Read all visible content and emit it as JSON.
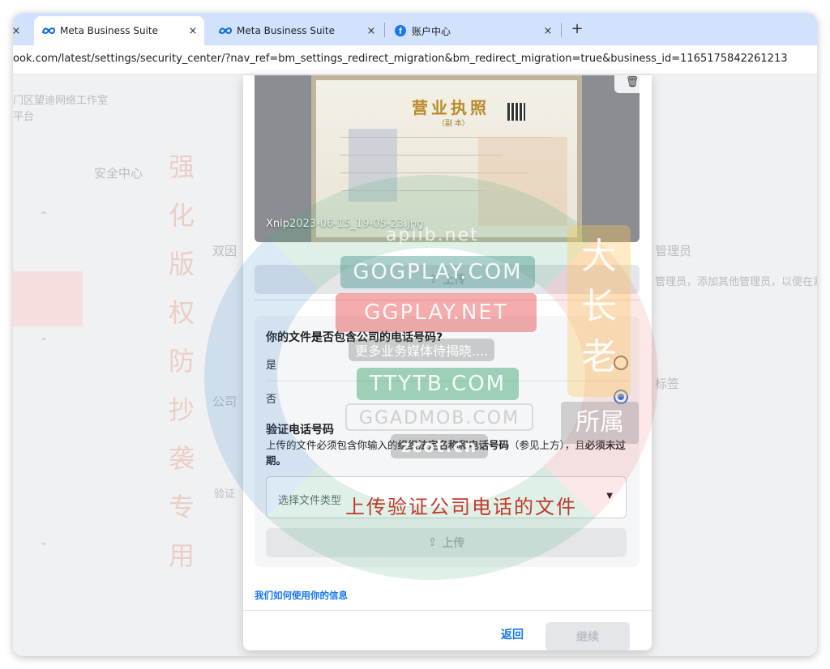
{
  "browser": {
    "tabs": [
      {
        "title": "Meta Business Suite",
        "icon": "meta-icon"
      },
      {
        "title": "Meta Business Suite",
        "icon": "meta-icon"
      },
      {
        "title": "账户中心",
        "icon": "facebook-icon"
      }
    ],
    "close_glyph": "×",
    "new_tab_glyph": "+",
    "url": "ook.com/latest/settings/security_center/?nav_ref=bm_settings_redirect_migration&bm_redirect_migration=true&business_id=1165175842261213"
  },
  "background": {
    "company_line": "门区望迪网络工作室",
    "company_sub": "平台",
    "security_center": "安全中心",
    "admin_heading": "管理员",
    "admin_desc": "管理员，添加其他管理员，以便在紧",
    "label_heading": "标签",
    "side_texts": [
      "双因",
      "公司",
      "验证"
    ]
  },
  "modal": {
    "file_name": "Xnip2023-06-15_19-05-23.jpg",
    "trash_icon": "trash-icon",
    "upload_label": "上传",
    "question": "你的文件是否包含公司的电话号码?",
    "options": [
      {
        "label": "是",
        "checked": false
      },
      {
        "label": "否",
        "checked": true
      }
    ],
    "verify_title": "验证电话号码",
    "verify_desc_pre": "上传的文件必须包含你输入的",
    "verify_desc_bold": "组织法定名称和电话号码",
    "verify_desc_mid": "（参见上方），且",
    "verify_desc_bold2": "必须未过期。",
    "select_placeholder": "选择文件类型",
    "upload_label_2": "上传",
    "info_link": "我们如何使用你的信息",
    "back_label": "返回",
    "continue_label": "继续"
  },
  "certificate": {
    "title": "营业执照",
    "subtitle": "（副 本）"
  },
  "watermarks": {
    "vertical": [
      "强",
      "化",
      "版",
      "权",
      "防",
      "抄",
      "袭",
      "专",
      "用"
    ],
    "boxes": [
      "apiib.net",
      "GOGPLAY.COM",
      "GGPLAY.NET",
      "更多业务媒体待揭晓....",
      "TTYTB.COM",
      "GGADMOB.COM",
      "zcot.cn"
    ],
    "orange": [
      "大",
      "长",
      "老"
    ],
    "gray": "所属",
    "red_caption": "上传验证公司电话的文件"
  },
  "colors": {
    "accent": "#1877f2",
    "tabstrip": "#d3e2fc"
  }
}
